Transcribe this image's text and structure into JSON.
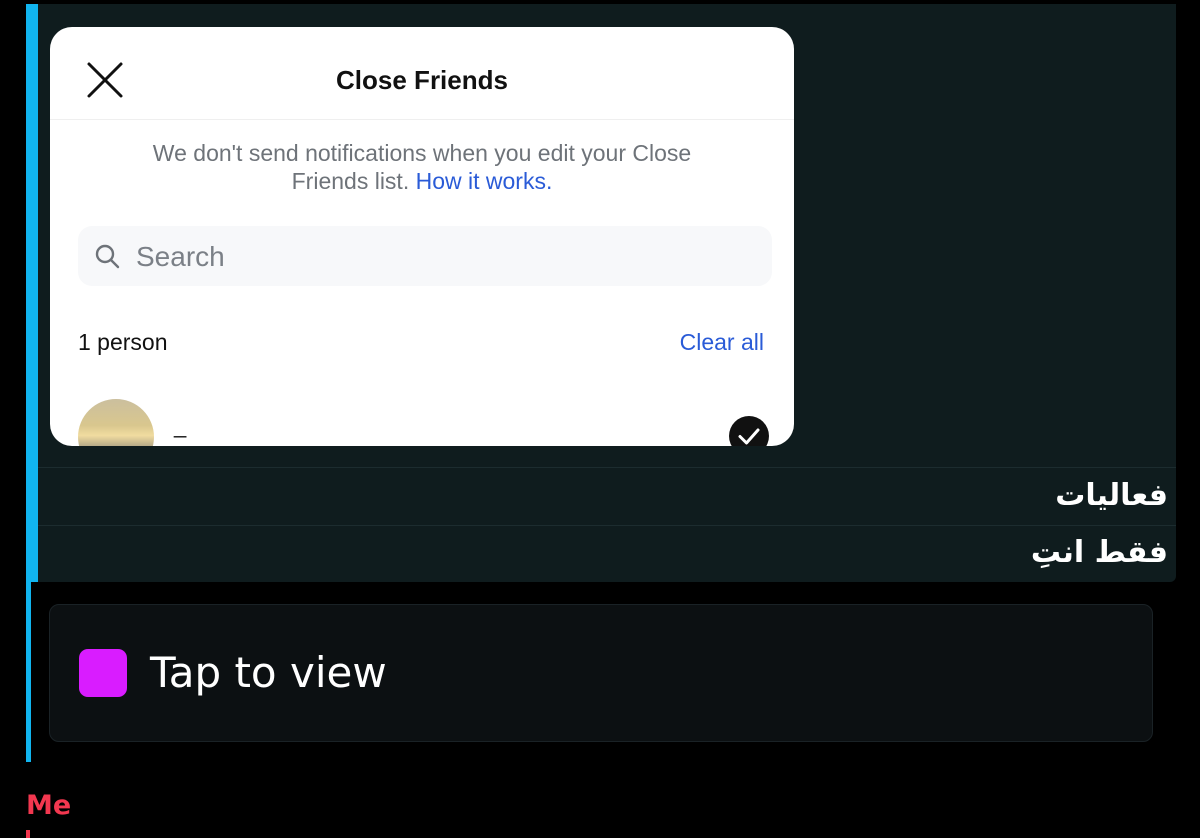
{
  "modal": {
    "title": "Close Friends",
    "notice": "We don't send notifications when you edit your Close Friends list.",
    "notice_link": "How it works.",
    "search_placeholder": "Search",
    "count_label": "1 person",
    "clear_all_label": "Clear all",
    "contacts": [
      {
        "name": "_",
        "selected": true
      }
    ]
  },
  "message_lines": [
    "فعاليات",
    "فقط انتِ"
  ],
  "attachment": {
    "label": "Tap to view",
    "icon": "media-square-icon",
    "icon_color": "#d91cff"
  },
  "sender": "Me",
  "colors": {
    "accent_bar": "#11b5f0",
    "link": "#2a5bd7",
    "sender": "#f2374f"
  }
}
